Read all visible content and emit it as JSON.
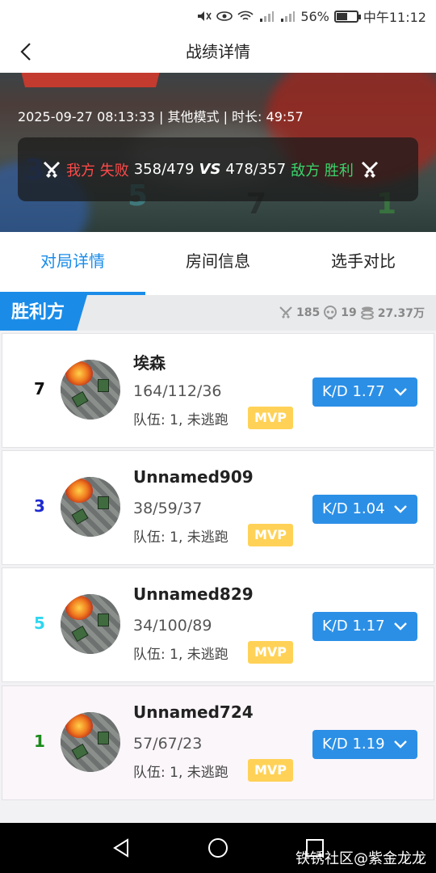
{
  "status_bar": {
    "battery": "56%",
    "time": "中午11:12"
  },
  "nav": {
    "title": "战绩详情"
  },
  "match": {
    "meta": "2025-09-27 08:13:33 | 其他模式 | 时长: 49:57",
    "our_label": "我方 失败",
    "our_score": "358/479",
    "vs": "VS",
    "enemy_score": "478/357",
    "enemy_label": "敌方 胜利"
  },
  "tabs": [
    {
      "label": "对局详情",
      "active": true
    },
    {
      "label": "房间信息",
      "active": false
    },
    {
      "label": "选手对比",
      "active": false
    }
  ],
  "winner_section": {
    "label": "胜利方",
    "kills": "185",
    "deaths": "19",
    "money": "27.37万"
  },
  "players": [
    {
      "rank": "7",
      "rank_color": "#111111",
      "name": "埃森",
      "kda": "164/112/36",
      "team": "队伍: 1, 未逃跑",
      "badge": "MVP",
      "kd": "K/D 1.77"
    },
    {
      "rank": "3",
      "rank_color": "#1e2bd0",
      "name": "Unnamed909",
      "kda": "38/59/37",
      "team": "队伍: 1, 未逃跑",
      "badge": "MVP",
      "kd": "K/D 1.04"
    },
    {
      "rank": "5",
      "rank_color": "#2ed6f0",
      "name": "Unnamed829",
      "kda": "34/100/89",
      "team": "队伍: 1, 未逃跑",
      "badge": "MVP",
      "kd": "K/D 1.17"
    },
    {
      "rank": "1",
      "rank_color": "#1a8a1a",
      "name": "Unnamed724",
      "kda": "57/67/23",
      "team": "队伍: 1, 未逃跑",
      "badge": "MVP",
      "kd": "K/D 1.19"
    }
  ],
  "watermark": "铁锈社区@紫金龙龙",
  "colors": {
    "accent": "#1a8ce8",
    "lose": "#ff4a4a",
    "win": "#3bd46b",
    "mvp": "#ffd257"
  }
}
